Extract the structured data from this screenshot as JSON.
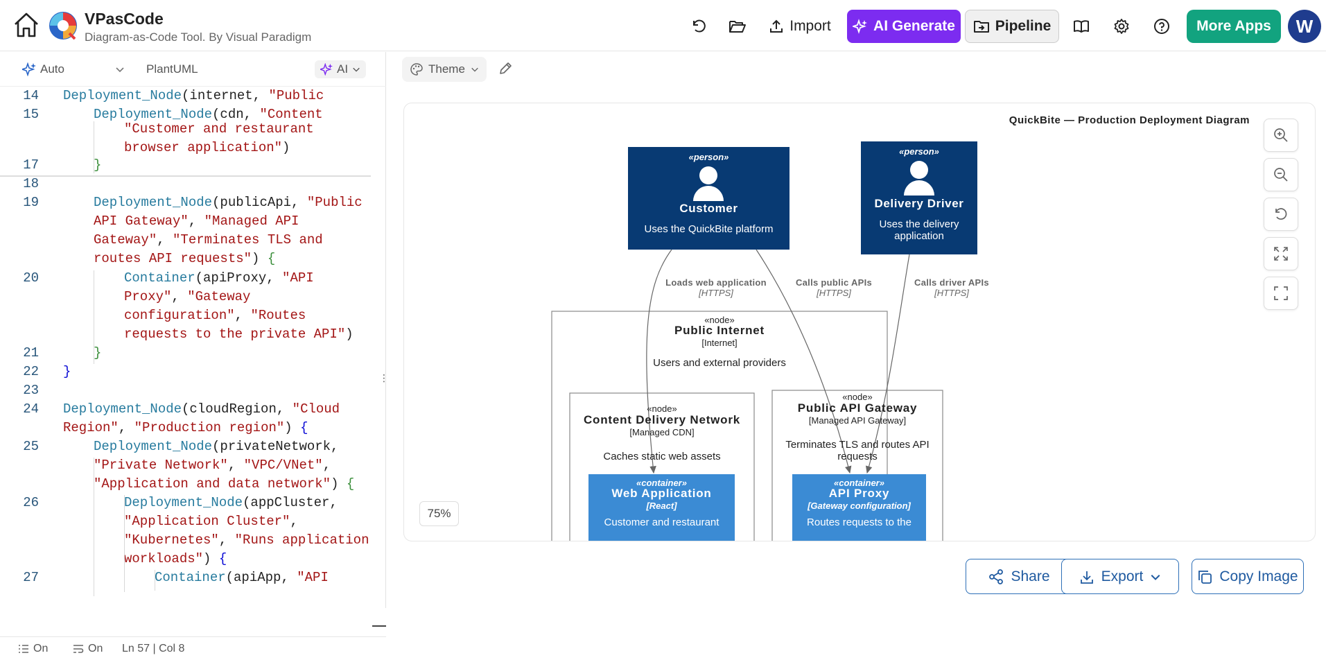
{
  "app": {
    "title": "VPasCode",
    "subtitle": "Diagram-as-Code Tool. By Visual Paradigm"
  },
  "toolbar": {
    "import_label": "Import",
    "ai_generate_label": "AI Generate",
    "pipeline_label": "Pipeline",
    "more_apps_label": "More Apps",
    "avatar_letter": "W"
  },
  "editor": {
    "mode_label": "Auto",
    "language_label": "PlantUML",
    "ai_label": "AI",
    "lines": [
      {
        "n": "14",
        "parts": [
          [
            "Deployment_Node",
            "kw"
          ],
          [
            "(internet, ",
            ""
          ],
          [
            "\"Public",
            "st"
          ]
        ]
      },
      {
        "n": "15",
        "parts": [
          [
            "Deployment_Node",
            "kw"
          ],
          [
            "(cdn, ",
            ""
          ],
          [
            "\"Content",
            "st"
          ]
        ]
      },
      {
        "n": "",
        "parts": [
          [
            "\"Customer and restaurant",
            "st"
          ]
        ]
      },
      {
        "n": "",
        "parts": [
          [
            "browser application\"",
            "st"
          ],
          [
            ")",
            ""
          ]
        ]
      },
      {
        "n": "17",
        "parts": [
          [
            "}",
            "br2"
          ]
        ]
      },
      {
        "n": "18",
        "parts": []
      },
      {
        "n": "19",
        "parts": [
          [
            "Deployment_Node",
            "kw"
          ],
          [
            "(publicApi, ",
            ""
          ],
          [
            "\"Public",
            "st"
          ]
        ]
      },
      {
        "n": "",
        "parts": [
          [
            "API Gateway\"",
            "st"
          ],
          [
            ", ",
            ""
          ],
          [
            "\"Managed API",
            "st"
          ]
        ]
      },
      {
        "n": "",
        "parts": [
          [
            "Gateway\"",
            "st"
          ],
          [
            ", ",
            ""
          ],
          [
            "\"Terminates TLS and",
            "st"
          ]
        ]
      },
      {
        "n": "",
        "parts": [
          [
            "routes API requests\"",
            "st"
          ],
          [
            ") ",
            ""
          ],
          [
            "{",
            "br2"
          ]
        ]
      },
      {
        "n": "20",
        "parts": [
          [
            "Container",
            "kw"
          ],
          [
            "(apiProxy, ",
            ""
          ],
          [
            "\"API",
            "st"
          ]
        ]
      },
      {
        "n": "",
        "parts": [
          [
            "Proxy\"",
            "st"
          ],
          [
            ", ",
            ""
          ],
          [
            "\"Gateway",
            "st"
          ]
        ]
      },
      {
        "n": "",
        "parts": [
          [
            "configuration\"",
            "st"
          ],
          [
            ", ",
            ""
          ],
          [
            "\"Routes",
            "st"
          ]
        ]
      },
      {
        "n": "",
        "parts": [
          [
            "requests to the private API\"",
            "st"
          ],
          [
            ")",
            ""
          ]
        ]
      },
      {
        "n": "21",
        "parts": [
          [
            "}",
            "br2"
          ]
        ]
      },
      {
        "n": "22",
        "parts": [
          [
            "}",
            "br"
          ]
        ]
      },
      {
        "n": "23",
        "parts": []
      },
      {
        "n": "24",
        "parts": [
          [
            "Deployment_Node",
            "kw"
          ],
          [
            "(cloudRegion, ",
            ""
          ],
          [
            "\"Cloud",
            "st"
          ]
        ]
      },
      {
        "n": "",
        "parts": [
          [
            "Region\"",
            "st"
          ],
          [
            ", ",
            ""
          ],
          [
            "\"Production region\"",
            "st"
          ],
          [
            ") ",
            ""
          ],
          [
            "{",
            "br"
          ]
        ]
      },
      {
        "n": "25",
        "parts": [
          [
            "Deployment_Node",
            "kw"
          ],
          [
            "(privateNetwork,",
            ""
          ]
        ]
      },
      {
        "n": "",
        "parts": [
          [
            "\"Private Network\"",
            "st"
          ],
          [
            ", ",
            ""
          ],
          [
            "\"VPC/VNet\"",
            "st"
          ],
          [
            ",",
            ""
          ]
        ]
      },
      {
        "n": "",
        "parts": [
          [
            "\"Application and data network\"",
            "st"
          ],
          [
            ") ",
            ""
          ],
          [
            "{",
            "br2"
          ]
        ]
      },
      {
        "n": "26",
        "parts": [
          [
            "Deployment_Node",
            "kw"
          ],
          [
            "(appCluster,",
            ""
          ]
        ]
      },
      {
        "n": "",
        "parts": [
          [
            "\"Application Cluster\"",
            "st"
          ],
          [
            ",",
            ""
          ]
        ]
      },
      {
        "n": "",
        "parts": [
          [
            "\"Kubernetes\"",
            "st"
          ],
          [
            ", ",
            ""
          ],
          [
            "\"Runs application",
            "st"
          ]
        ]
      },
      {
        "n": "",
        "parts": [
          [
            "workloads\"",
            "st"
          ],
          [
            ") ",
            ""
          ],
          [
            "{",
            "br"
          ]
        ]
      },
      {
        "n": "27",
        "parts": [
          [
            "Container",
            "kw"
          ],
          [
            "(apiApp, ",
            ""
          ],
          [
            "\"API",
            "st"
          ]
        ]
      }
    ],
    "status": {
      "wrap1": "On",
      "wrap2": "On",
      "position": "Ln 57 | Col 8"
    }
  },
  "preview": {
    "theme_label": "Theme",
    "zoom_level": "75%",
    "share_label": "Share",
    "export_label": "Export",
    "copy_image_label": "Copy Image"
  },
  "diagram": {
    "title": "QuickBite — Production Deployment Diagram",
    "customer": {
      "stereotype": "«person»",
      "name": "Customer",
      "desc": "Uses the QuickBite platform"
    },
    "driver": {
      "stereotype": "«person»",
      "name": "Delivery Driver",
      "desc1": "Uses the delivery",
      "desc2": "application"
    },
    "edge1": {
      "label": "Loads web application",
      "tech": "[HTTPS]"
    },
    "edge2": {
      "label": "Calls public APIs",
      "tech": "[HTTPS]"
    },
    "edge3": {
      "label": "Calls driver APIs",
      "tech": "[HTTPS]"
    },
    "internet": {
      "stereotype": "«node»",
      "name": "Public Internet",
      "tech": "[Internet]",
      "desc": "Users and external providers"
    },
    "cdn": {
      "stereotype": "«node»",
      "name": "Content Delivery Network",
      "tech": "[Managed CDN]",
      "desc": "Caches static web assets"
    },
    "gateway": {
      "stereotype": "«node»",
      "name": "Public API Gateway",
      "tech": "[Managed API Gateway]",
      "desc1": "Terminates TLS and routes API",
      "desc2": "requests"
    },
    "webapp": {
      "stereotype": "«container»",
      "name": "Web Application",
      "tech": "[React]",
      "desc": "Customer and restaurant"
    },
    "apiproxy": {
      "stereotype": "«container»",
      "name": "API Proxy",
      "tech": "[Gateway configuration]",
      "desc": "Routes requests to the"
    },
    "colors": {
      "person": "#083a73",
      "container": "#3b8bd4",
      "accent": "#7c2cf0",
      "green": "#12a37f"
    }
  }
}
